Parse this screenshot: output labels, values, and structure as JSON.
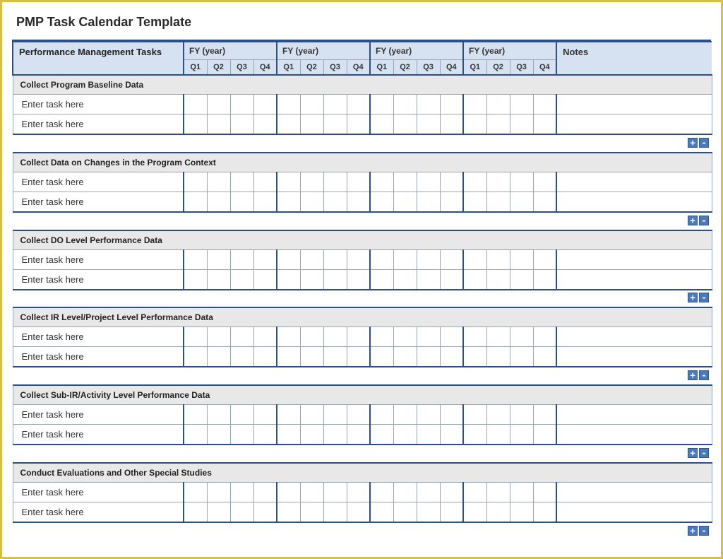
{
  "title": "PMP Task Calendar Template",
  "header": {
    "tasks_label": "Performance Management Tasks",
    "fy_label": "FY  (year)",
    "quarters": [
      "Q1",
      "Q2",
      "Q3",
      "Q4"
    ],
    "notes_label": "Notes"
  },
  "placeholders": {
    "task": "Enter task here"
  },
  "sections": [
    {
      "title": "Collect Program Baseline Data",
      "rows": 2
    },
    {
      "title": "Collect Data on Changes in the Program Context",
      "rows": 2
    },
    {
      "title": "Collect DO Level Performance Data",
      "rows": 2
    },
    {
      "title": "Collect IR Level/Project Level Performance Data",
      "rows": 2
    },
    {
      "title": "Collect Sub-IR/Activity Level Performance Data",
      "rows": 2
    },
    {
      "title": "Conduct Evaluations and Other Special Studies",
      "rows": 2
    }
  ],
  "controls": {
    "add": "+",
    "remove": "-"
  }
}
